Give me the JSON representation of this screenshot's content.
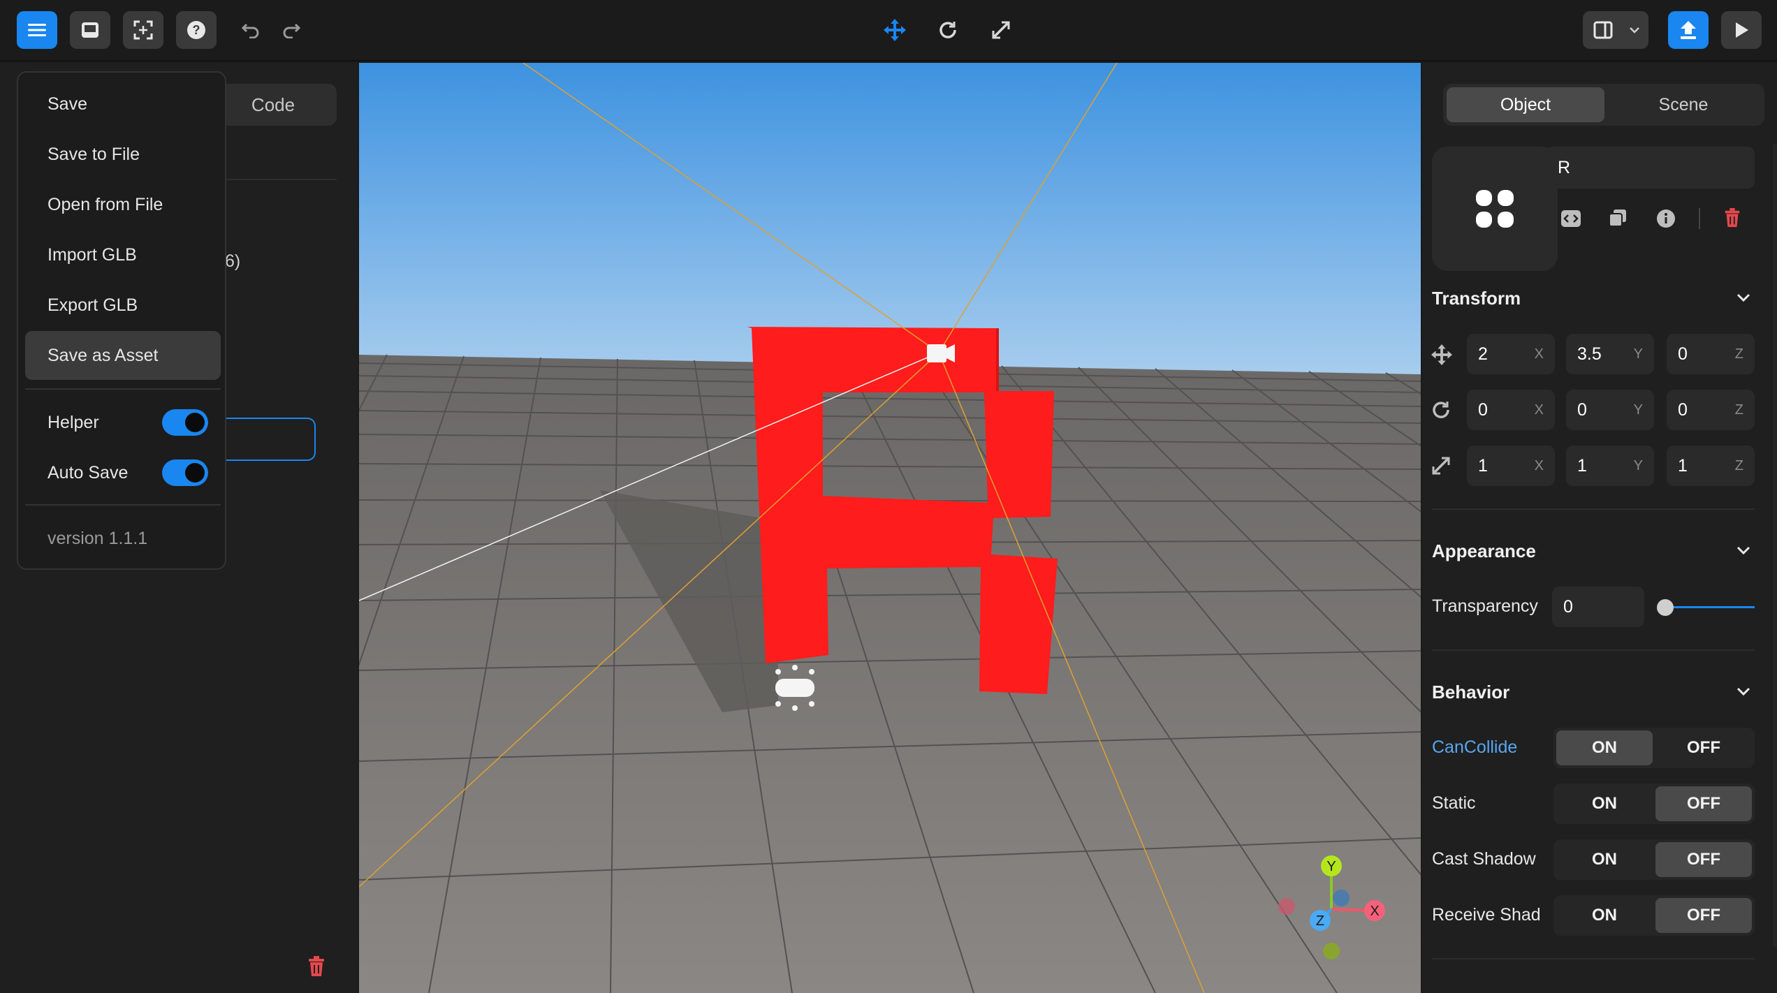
{
  "toolbar": {
    "menu_icon": "hamburger-icon",
    "panel_icon": "inbox-icon",
    "fullscreen_icon": "focus-icon",
    "help_icon": "help-icon",
    "undo_icon": "undo-icon",
    "redo_icon": "redo-icon",
    "move_icon": "move-icon",
    "rotate_icon": "rotate-icon",
    "scale_icon": "scale-icon",
    "layout_icon": "layout-icon",
    "upload_icon": "upload-icon",
    "play_icon": "play-icon",
    "accent": "#1a86f0"
  },
  "left": {
    "code_tab": "Code",
    "partial_text": "6)"
  },
  "menu": {
    "items": [
      "Save",
      "Save to File",
      "Open from File",
      "Import GLB",
      "Export GLB",
      "Save as Asset"
    ],
    "toggles": [
      {
        "label": "Helper",
        "on": true
      },
      {
        "label": "Auto Save",
        "on": true
      }
    ],
    "version": "version 1.1.1"
  },
  "right": {
    "tabs": [
      "Object",
      "Scene"
    ],
    "active_tab": "Object",
    "object_name": "R",
    "transform": {
      "title": "Transform",
      "position": [
        "2",
        "3.5",
        "0"
      ],
      "rotation": [
        "0",
        "0",
        "0"
      ],
      "scale": [
        "1",
        "1",
        "1"
      ],
      "axes": [
        "X",
        "Y",
        "Z"
      ]
    },
    "appearance": {
      "title": "Appearance",
      "transparency_label": "Transparency",
      "transparency_value": "0",
      "transparency_level": 0
    },
    "behavior": {
      "title": "Behavior",
      "rows": [
        {
          "label": "CanCollide",
          "value": "ON",
          "highlight": true
        },
        {
          "label": "Static",
          "value": "OFF"
        },
        {
          "label": "Cast Shadow",
          "value": "OFF"
        },
        {
          "label": "Receive Shad",
          "value": "OFF"
        }
      ],
      "on_label": "ON",
      "off_label": "OFF"
    }
  },
  "gizmo": {
    "x": "X",
    "y": "Y",
    "z": "Z"
  }
}
